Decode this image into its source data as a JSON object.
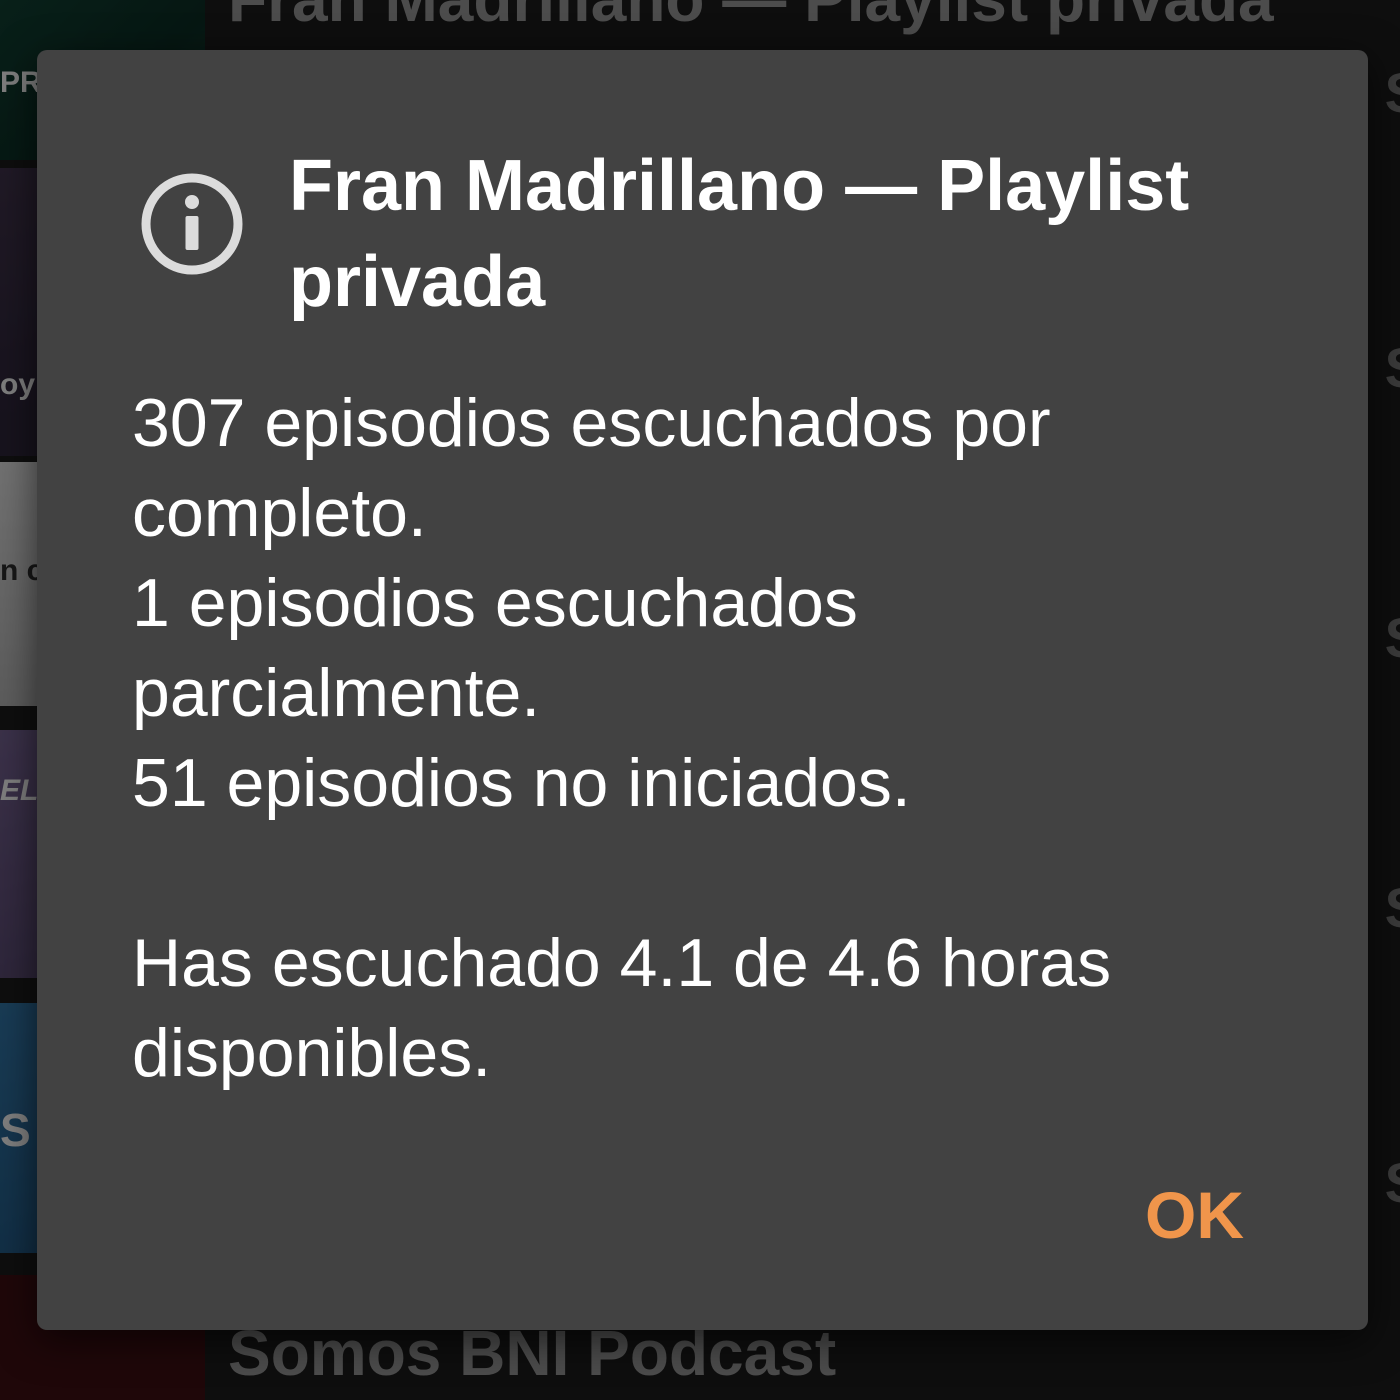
{
  "background": {
    "top_title": "Fran Madrillano — Playlist privada",
    "bottom_title": "Somos BNI Podcast",
    "thumbnails": [
      {
        "name": "podcast-thumb-1",
        "text": "PR"
      },
      {
        "name": "podcast-thumb-2",
        "text": "oy"
      },
      {
        "name": "podcast-thumb-3",
        "text": "n c TE"
      },
      {
        "name": "podcast-thumb-4",
        "text": "EL"
      },
      {
        "name": "podcast-thumb-5",
        "text": "S"
      },
      {
        "name": "podcast-thumb-6",
        "text": ""
      }
    ]
  },
  "dialog": {
    "icon": "info-icon",
    "title": "Fran Madrillano — Playlist privada",
    "body_lines": [
      "307 episodios escuchados por completo.",
      "1 episodios escuchados parcialmente.",
      "51 episodios no iniciados."
    ],
    "summary": "Has escuchado 4.1 de 4.6 horas disponibles.",
    "ok_label": "OK"
  },
  "colors": {
    "dialog_bg": "#424242",
    "accent": "#f0954b",
    "text": "#ffffff"
  }
}
